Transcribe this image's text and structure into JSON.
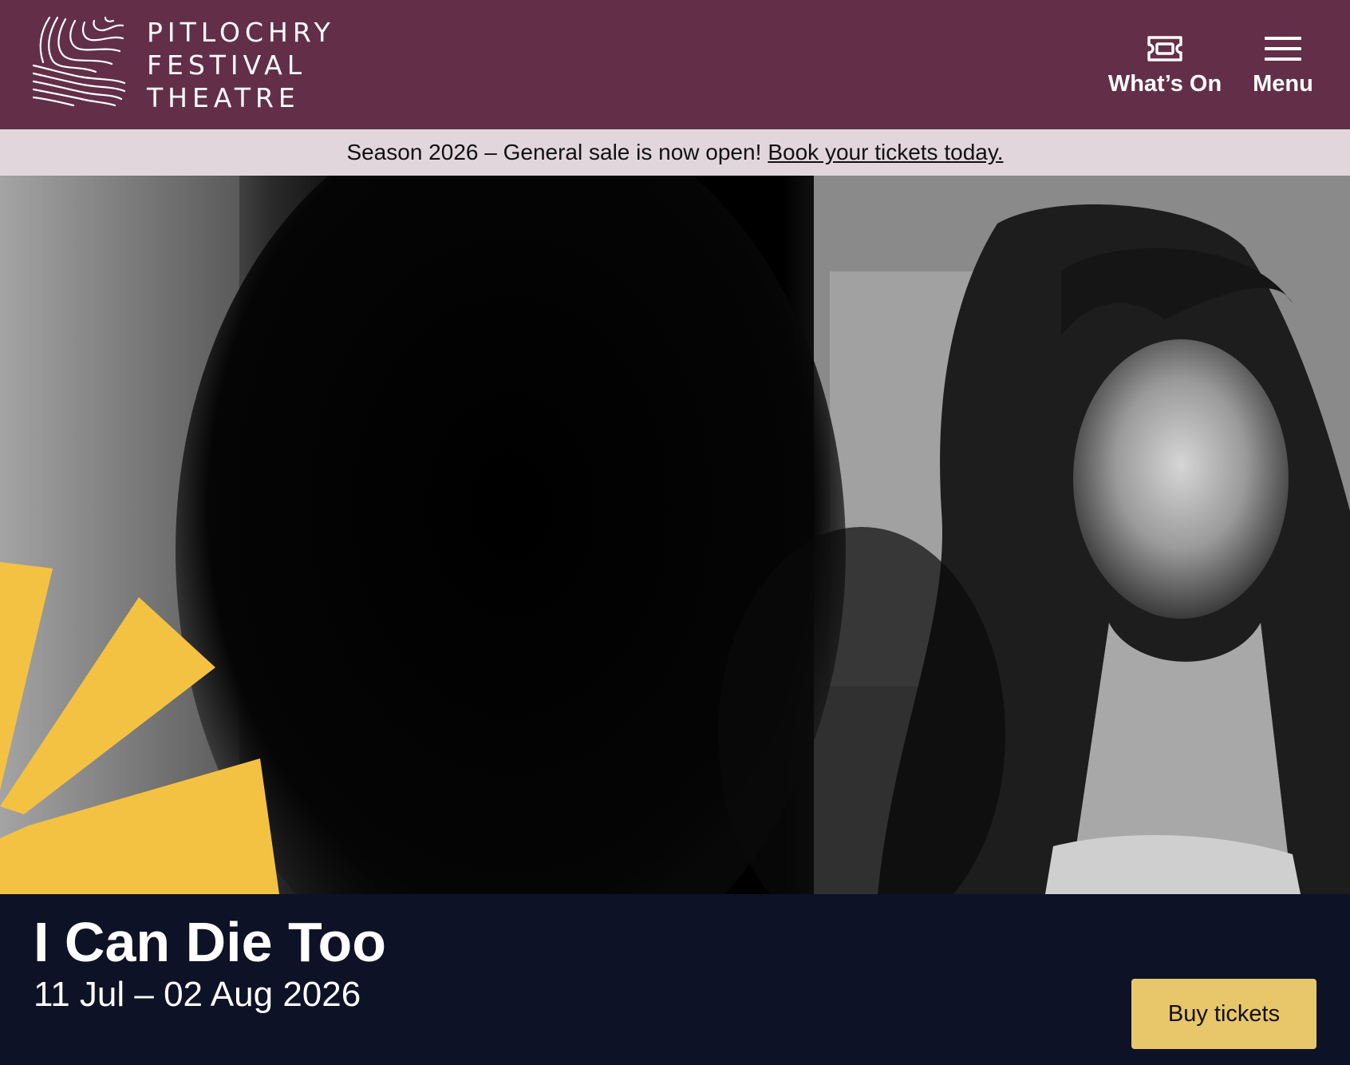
{
  "header": {
    "logo_lines": [
      "PITLOCHRY",
      "FESTIVAL",
      "THEATRE"
    ],
    "nav": {
      "whats_on": {
        "label": "What’s On",
        "icon": "ticket-icon"
      },
      "menu": {
        "label": "Menu",
        "icon": "hamburger-menu-icon"
      }
    }
  },
  "announcement": {
    "text": "Season 2026 – General sale is now open!",
    "link_text": "Book your tickets today."
  },
  "hero": {
    "image": "black-and-white-photo-woman-with-long-dark-hair",
    "accent_color": "#f4c242"
  },
  "show": {
    "title": "I Can Die Too",
    "dates": "11 Jul – 02 Aug 2026",
    "cta_label": "Buy tickets"
  },
  "colors": {
    "header_bg": "#632f48",
    "announce_bg": "#e2d6dd",
    "band_bg": "#0d1226",
    "button_bg": "#e8c66a"
  }
}
